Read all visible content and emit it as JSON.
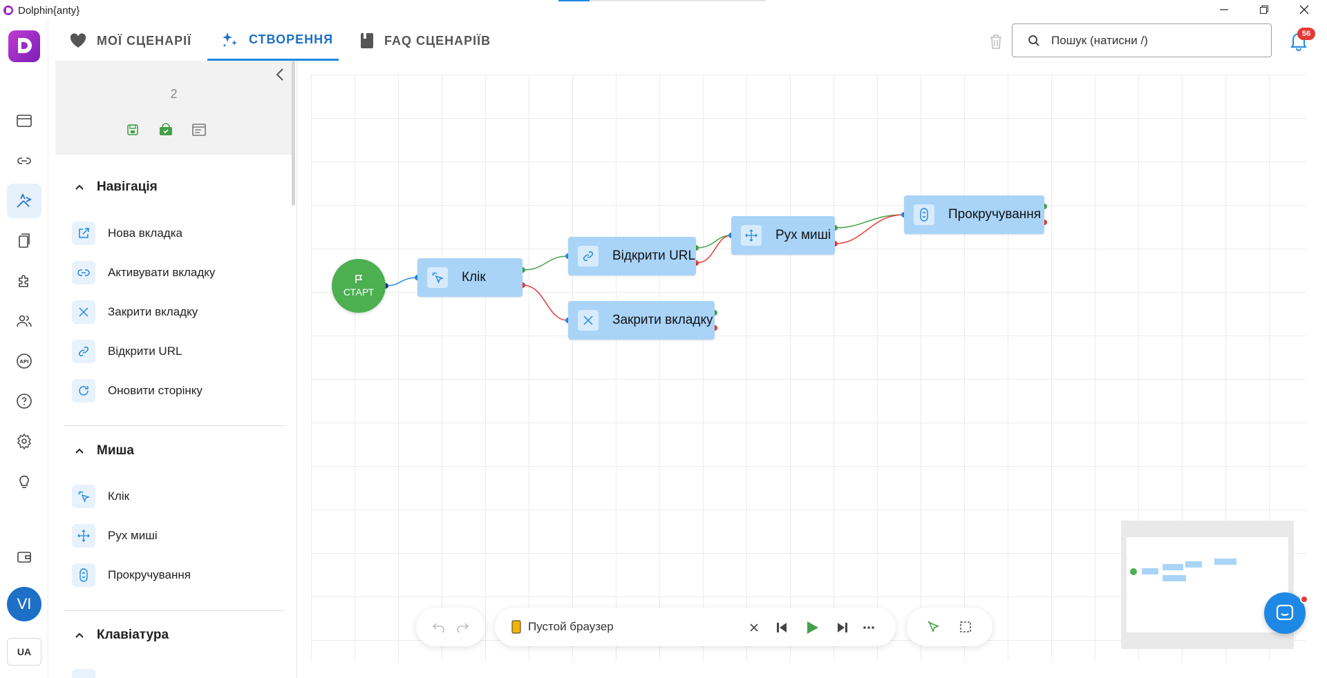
{
  "window": {
    "title": "Dolphin{anty}",
    "loading_progress": 0.15
  },
  "tabs": [
    {
      "label": "МОЇ СЦЕНАРІЇ",
      "icon": "heart-icon",
      "active": false
    },
    {
      "label": "СТВОРЕННЯ",
      "icon": "sparkles-icon",
      "active": true
    },
    {
      "label": "FAQ СЦЕНАРІЇВ",
      "icon": "book-icon",
      "active": false
    }
  ],
  "search": {
    "placeholder": "Пошук (натисни /)"
  },
  "notifications": {
    "count": "56"
  },
  "rail": {
    "items": [
      "browser-profiles-icon",
      "proxy-link-icon",
      "scenarios-icon",
      "bookmarks-icon",
      "extensions-icon",
      "users-icon",
      "api-icon",
      "help-icon",
      "settings-icon",
      "ideas-icon",
      "wallet-icon"
    ],
    "active": "scenarios-icon",
    "avatar": "VI",
    "language": "UA"
  },
  "panel": {
    "scenario_name": "2",
    "sections": [
      {
        "title": "Навігація",
        "actions": [
          {
            "label": "Нова вкладка",
            "icon": "new-tab-icon"
          },
          {
            "label": "Активувати вкладку",
            "icon": "link-icon"
          },
          {
            "label": "Закрити вкладку",
            "icon": "close-icon"
          },
          {
            "label": "Відкрити URL",
            "icon": "url-link-icon"
          },
          {
            "label": "Оновити сторінку",
            "icon": "refresh-icon"
          }
        ]
      },
      {
        "title": "Миша",
        "actions": [
          {
            "label": "Клік",
            "icon": "cursor-click-icon"
          },
          {
            "label": "Рух миші",
            "icon": "move-icon"
          },
          {
            "label": "Прокручування",
            "icon": "scroll-icon"
          }
        ]
      },
      {
        "title": "Клавіатура",
        "actions": []
      }
    ]
  },
  "canvas": {
    "start_label": "СТАРТ",
    "nodes": [
      {
        "id": "click",
        "label": "Клік",
        "icon": "cursor-click-icon"
      },
      {
        "id": "open-url",
        "label": "Відкрити URL",
        "icon": "url-link-icon"
      },
      {
        "id": "close-tab",
        "label": "Закрити вкладку",
        "icon": "close-icon"
      },
      {
        "id": "mouse-move",
        "label": "Рух миші",
        "icon": "move-icon"
      },
      {
        "id": "scroll",
        "label": "Прокручування",
        "icon": "scroll-icon"
      }
    ],
    "connections": [
      {
        "from": "start",
        "to": "click",
        "type": "default"
      },
      {
        "from": "click",
        "to": "open-url",
        "type": "success"
      },
      {
        "from": "click",
        "to": "close-tab",
        "type": "error"
      },
      {
        "from": "open-url",
        "to": "mouse-move",
        "type": "success"
      },
      {
        "from": "open-url",
        "to": "mouse-move",
        "type": "error"
      },
      {
        "from": "mouse-move",
        "to": "scroll",
        "type": "success"
      },
      {
        "from": "mouse-move",
        "to": "scroll",
        "type": "error"
      }
    ]
  },
  "toolbar": {
    "browser_label": "Пустой браузер",
    "browser_color": "#f5b400"
  },
  "colors": {
    "accent": "#1e88e5",
    "node": "#a9d4f8",
    "start": "#4caf50",
    "success": "#43a047",
    "error": "#e53935"
  }
}
